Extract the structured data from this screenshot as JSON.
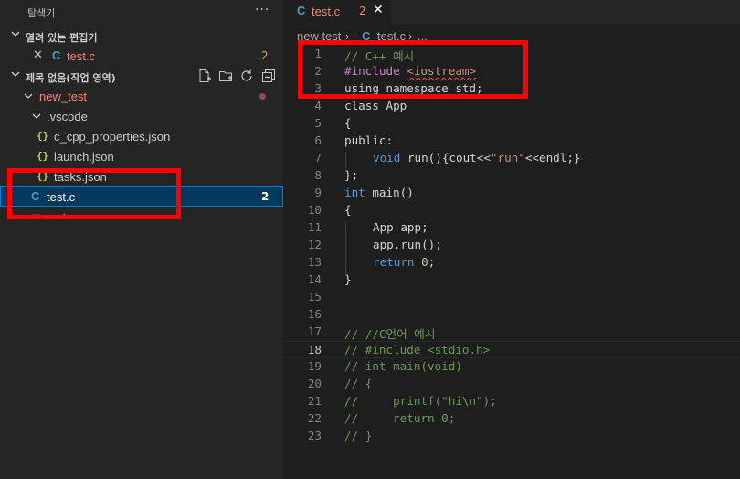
{
  "sidebar": {
    "title": "탐색기",
    "more": "···",
    "open_editors": {
      "label": "열려 있는 편집기",
      "items": [
        {
          "icon": "C",
          "name": "test.c",
          "badge": "2"
        }
      ]
    },
    "workspace": {
      "label": "제목 없음(작업 영역)",
      "tree": {
        "folder": "new_test",
        "subfolder": ".vscode",
        "json_files": [
          "c_cpp_properties.json",
          "launch.json",
          "tasks.json"
        ],
        "json_icon": "{}",
        "test_c": {
          "icon": "C",
          "name": "test.c",
          "badge": "2"
        },
        "partial_item": "test.exe"
      }
    }
  },
  "editor": {
    "tab": {
      "icon": "C",
      "name": "test.c",
      "badge": "2",
      "close": "✕"
    },
    "breadcrumb": {
      "folder": "new test",
      "sep": "›",
      "icon": "C",
      "file": "test.c",
      "tail": "..."
    },
    "current_line": 18,
    "lines": [
      {
        "n": "1"
      },
      {
        "n": "2"
      },
      {
        "n": "3"
      },
      {
        "n": "4"
      },
      {
        "n": "5"
      },
      {
        "n": "6"
      },
      {
        "n": "7"
      },
      {
        "n": "8"
      },
      {
        "n": "9"
      },
      {
        "n": "10"
      },
      {
        "n": "11"
      },
      {
        "n": "12"
      },
      {
        "n": "13"
      },
      {
        "n": "14"
      },
      {
        "n": "15"
      },
      {
        "n": "16"
      },
      {
        "n": "17"
      },
      {
        "n": "18"
      },
      {
        "n": "19"
      },
      {
        "n": "20"
      },
      {
        "n": "21"
      },
      {
        "n": "22"
      },
      {
        "n": "23"
      }
    ],
    "code": {
      "l1": "// C++ 예시",
      "l2a": "#include ",
      "l2b": "<iostream>",
      "l3": "using namespace std;",
      "l4": "class App",
      "l5": "{",
      "l6": "public:",
      "l7a": "void",
      "l7b": " run(){cout<<",
      "l7c": "\"run\"",
      "l7d": "<<endl;}",
      "l8": "};",
      "l9a": "int",
      "l9b": " main()",
      "l10": "{",
      "l11": "App app;",
      "l12": "app.run();",
      "l13a": "return",
      "l13b": "0",
      "l13c": ";",
      "l14": "}",
      "l17": "// //C언어 예시",
      "l18": "// #include <stdio.h>",
      "l19": "// int main(void)",
      "l20": "// {",
      "l21": "//     printf(\"hi\\n\");",
      "l22": "//     return 0;",
      "l23": "// }"
    }
  }
}
